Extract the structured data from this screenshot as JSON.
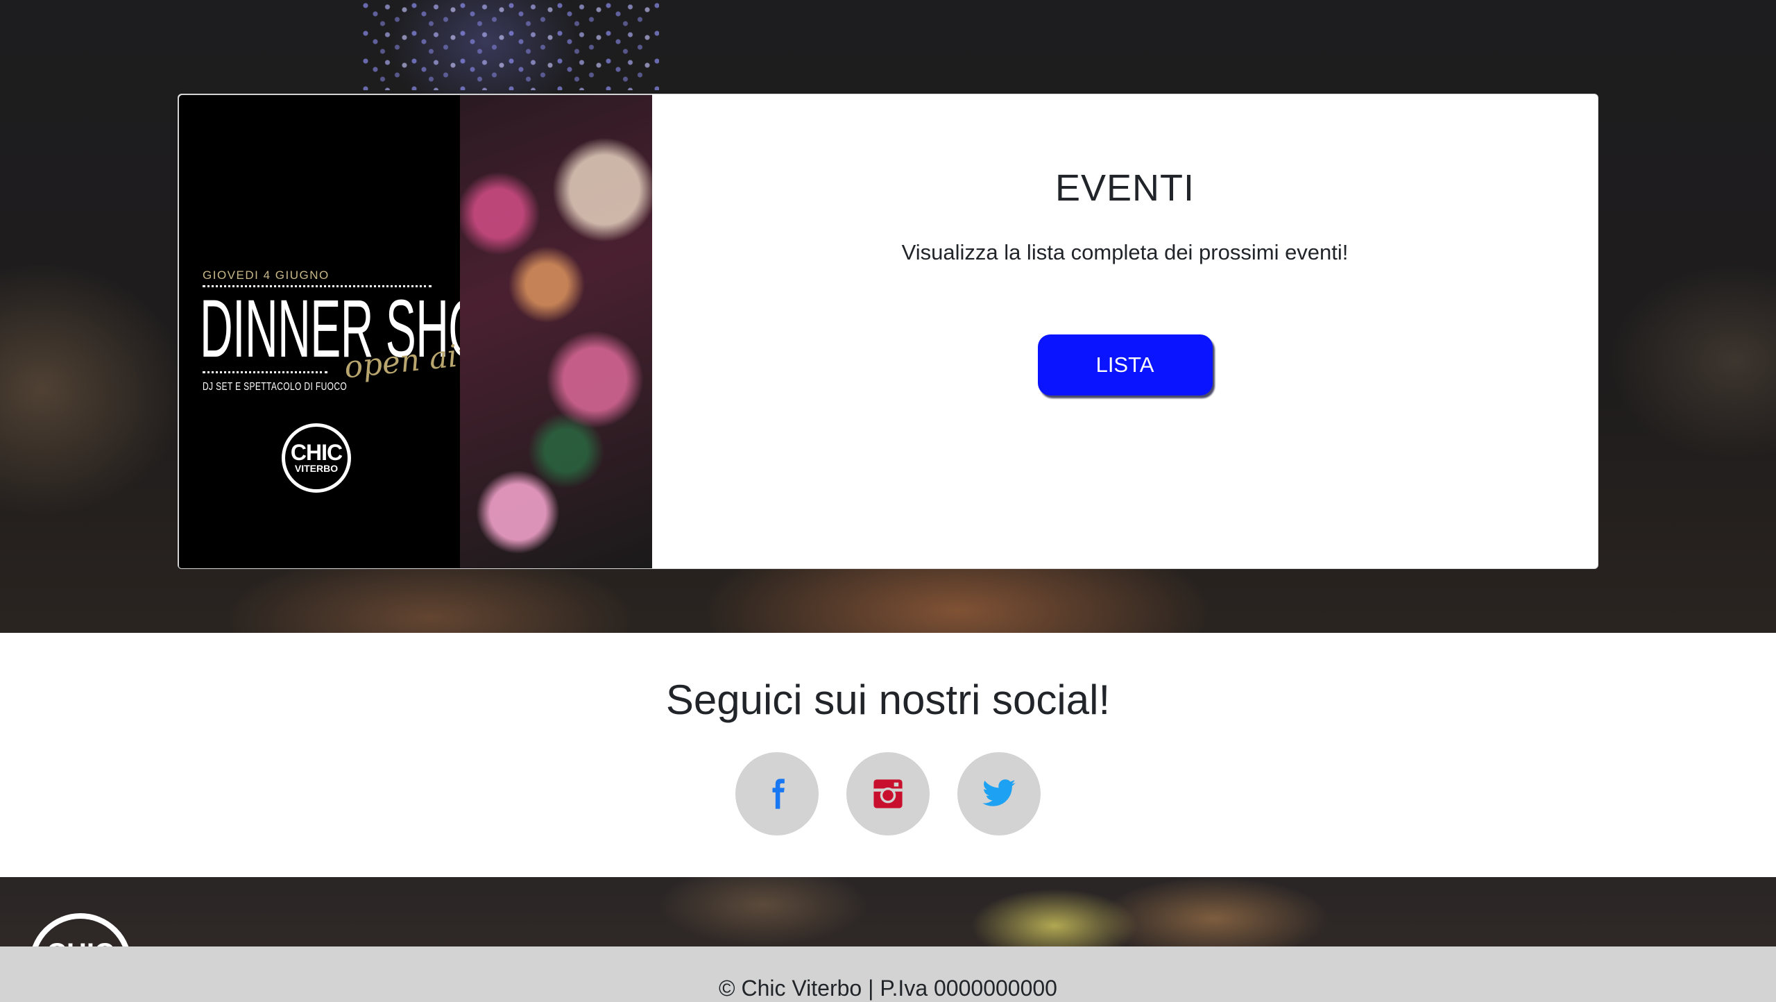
{
  "event_section": {
    "poster": {
      "date": "GIOVEDI 4 GIUGNO",
      "title": "DINNER SHOW",
      "script": "open air",
      "subtitle": "DJ SET E SPETTACOLO DI FUOCO",
      "logo_line1": "CHIC",
      "logo_line2": "VITERBO"
    },
    "title": "EVENTI",
    "text": "Visualizza la lista completa dei prossimi eventi!",
    "button_label": "LISTA",
    "button_color": "#0a14ff"
  },
  "social": {
    "title": "Seguici sui nostri social!",
    "icons": [
      {
        "name": "facebook-icon",
        "color": "#1877f2"
      },
      {
        "name": "instagram-icon",
        "color": "#c8102e"
      },
      {
        "name": "twitter-icon",
        "color": "#1da1f2"
      }
    ]
  },
  "footer": {
    "logo_text": "CHIC",
    "copyright": "© Chic Viterbo | P.Iva 0000000000"
  }
}
